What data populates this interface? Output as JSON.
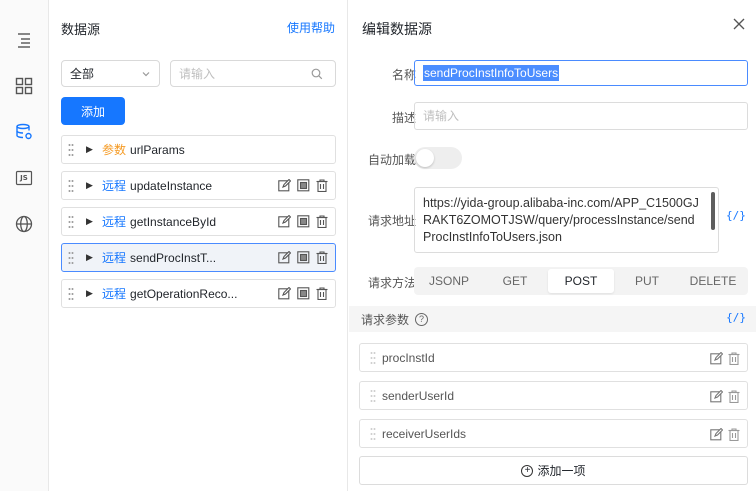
{
  "colors": {
    "accent": "#1677ff",
    "param_tag": "#f59a23",
    "selected_bg": "#f0f3f8"
  },
  "rail": {
    "items": [
      {
        "icon": "outline-tree-icon"
      },
      {
        "icon": "components-grid-icon"
      },
      {
        "icon": "datasource-icon",
        "active": true
      },
      {
        "icon": "js-code-icon",
        "label": "JS"
      },
      {
        "icon": "globe-icon"
      }
    ]
  },
  "list": {
    "title": "数据源",
    "help_link": "使用帮助",
    "filter_value": "全部",
    "search_placeholder": "请输入",
    "add_label": "添加",
    "items": [
      {
        "tag": "参数",
        "type": "param",
        "name": "urlParams"
      },
      {
        "tag": "远程",
        "type": "remote",
        "name": "updateInstance"
      },
      {
        "tag": "远程",
        "type": "remote",
        "name": "getInstanceById"
      },
      {
        "tag": "远程",
        "type": "remote",
        "name": "sendProcInstT...",
        "selected": true
      },
      {
        "tag": "远程",
        "type": "remote",
        "name": "getOperationReco..."
      }
    ]
  },
  "editor": {
    "title": "编辑数据源",
    "name_label": "名称",
    "name_value": "sendProcInstInfoToUsers",
    "desc_label": "描述",
    "desc_placeholder": "请输入",
    "autoload_label": "自动加载",
    "autoload_on": false,
    "url_label": "请求地址",
    "url_value": "https://yida-group.alibaba-inc.com/APP_C1500GJRAKT6ZOMOTJSW/query/processInstance/sendProcInstInfoToUsers.json",
    "code_toggle": "{/}",
    "method_label": "请求方法",
    "methods": [
      "JSONP",
      "GET",
      "POST",
      "PUT",
      "DELETE"
    ],
    "method_selected": "POST",
    "params_title": "请求参数",
    "params_help": "?",
    "params_code": "{/}",
    "params": [
      "procInstId",
      "senderUserId",
      "receiverUserIds"
    ],
    "add_item_label": "添加一项"
  }
}
